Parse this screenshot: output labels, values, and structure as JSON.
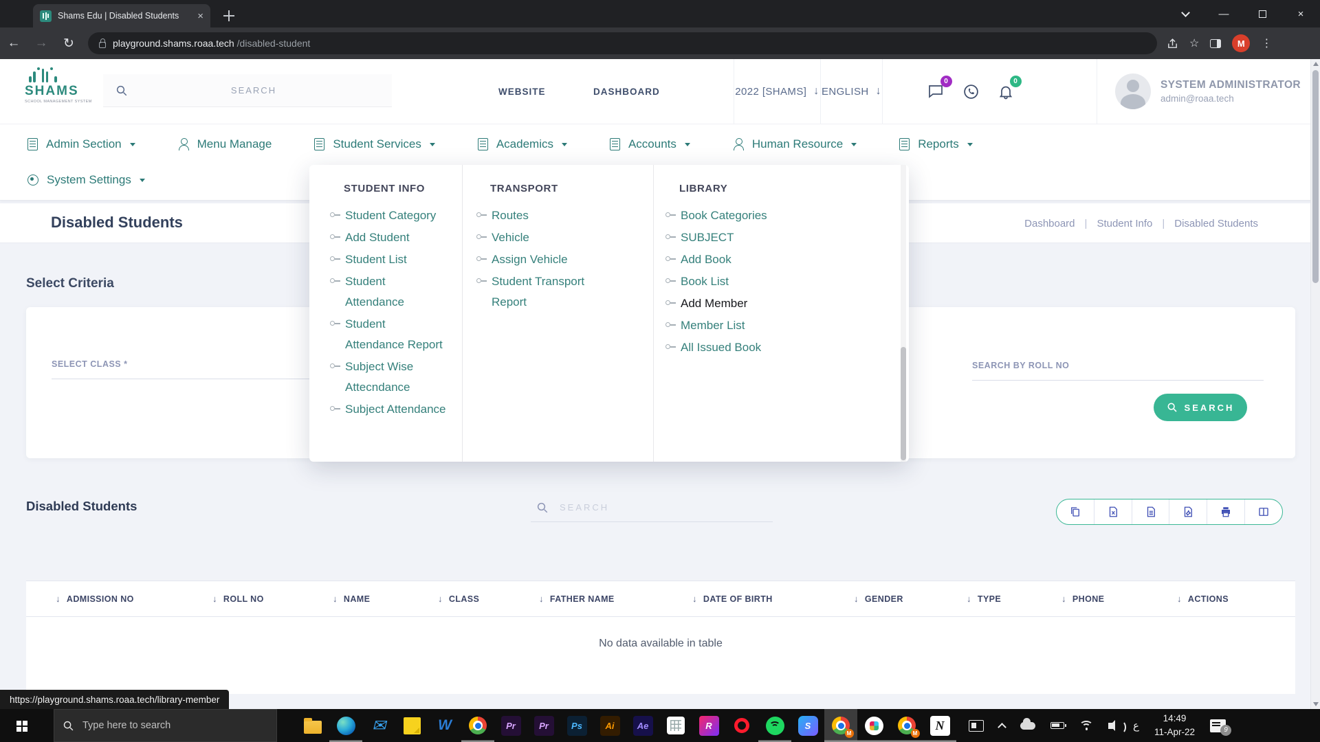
{
  "browser": {
    "tab_title": "Shams Edu | Disabled Students",
    "url_host": "playground.shams.roaa.tech",
    "url_path": "/disabled-student",
    "profile_initial": "M"
  },
  "header": {
    "logo_title": "SHAMS",
    "logo_subtitle": "SCHOOL MANAGEMENT SYSTEM",
    "search_placeholder": "SEARCH",
    "website_link": "WEBSITE",
    "dashboard_link": "DASHBOARD",
    "year_selector": "2022 [SHAMS]",
    "language_selector": "ENGLISH",
    "chat_badge": "0",
    "bell_badge": "0",
    "user_name": "SYSTEM ADMINISTRATOR",
    "user_email": "admin@roaa.tech"
  },
  "nav": {
    "row1": [
      {
        "label": "Admin Section"
      },
      {
        "label": "Menu Manage"
      },
      {
        "label": "Student Services"
      },
      {
        "label": "Academics"
      },
      {
        "label": "Accounts"
      },
      {
        "label": "Human Resource"
      },
      {
        "label": "Reports"
      }
    ],
    "row2": [
      {
        "label": "System Settings"
      }
    ]
  },
  "mega_menu": {
    "columns": [
      {
        "title": "STUDENT INFO",
        "items": [
          "Student Category",
          "Add Student",
          "Student List",
          "Student Attendance",
          "Student Attendance Report",
          "Subject Wise Attecndance",
          "Subject Attendance"
        ]
      },
      {
        "title": "TRANSPORT",
        "items": [
          "Routes",
          "Vehicle",
          "Assign Vehicle",
          "Student Transport Report"
        ]
      },
      {
        "title": "LIBRARY",
        "items": [
          "Book Categories",
          "SUBJECT",
          "Add Book",
          "Book List",
          "Add Member",
          "Member List",
          "All Issued Book"
        ],
        "active_item": "Add Member"
      }
    ]
  },
  "page": {
    "title": "Disabled Students",
    "breadcrumb": [
      "Dashboard",
      "Student Info",
      "Disabled Students"
    ],
    "select_criteria": "Select Criteria",
    "select_class_label": "SELECT CLASS *",
    "roll_no_label": "SEARCH BY ROLL NO",
    "search_button": "SEARCH",
    "table_title": "Disabled Students",
    "table_search_placeholder": "SEARCH",
    "table_headers": [
      "ADMISSION NO",
      "ROLL NO",
      "NAME",
      "CLASS",
      "FATHER NAME",
      "DATE OF BIRTH",
      "GENDER",
      "TYPE",
      "PHONE",
      "ACTIONS"
    ],
    "empty_message": "No data available in table"
  },
  "status_tooltip": "https://playground.shams.roaa.tech/library-member",
  "taskbar": {
    "search_placeholder": "Type here to search",
    "apps": [
      {
        "name": "file-explorer",
        "label": ""
      },
      {
        "name": "edge",
        "label": ""
      },
      {
        "name": "mail",
        "label": "✉"
      },
      {
        "name": "sticky-notes",
        "label": ""
      },
      {
        "name": "word",
        "label": "W"
      },
      {
        "name": "chrome",
        "label": ""
      },
      {
        "name": "premiere",
        "label": "Pr"
      },
      {
        "name": "premiere-2",
        "label": "Pr"
      },
      {
        "name": "photoshop",
        "label": "Ps"
      },
      {
        "name": "illustrator",
        "label": "Ai"
      },
      {
        "name": "after-effects",
        "label": "Ae"
      },
      {
        "name": "calculator",
        "label": ""
      },
      {
        "name": "rider",
        "label": "R"
      },
      {
        "name": "opera",
        "label": ""
      },
      {
        "name": "spotify",
        "label": ""
      },
      {
        "name": "skype",
        "label": "S"
      },
      {
        "name": "chrome-profile",
        "label": "M"
      },
      {
        "name": "slack",
        "label": ""
      },
      {
        "name": "chrome-profile-2",
        "label": "M"
      },
      {
        "name": "notion",
        "label": "N"
      }
    ],
    "language": "ع",
    "time": "14:49",
    "date": "11-Apr-22",
    "notification_count": "9"
  }
}
